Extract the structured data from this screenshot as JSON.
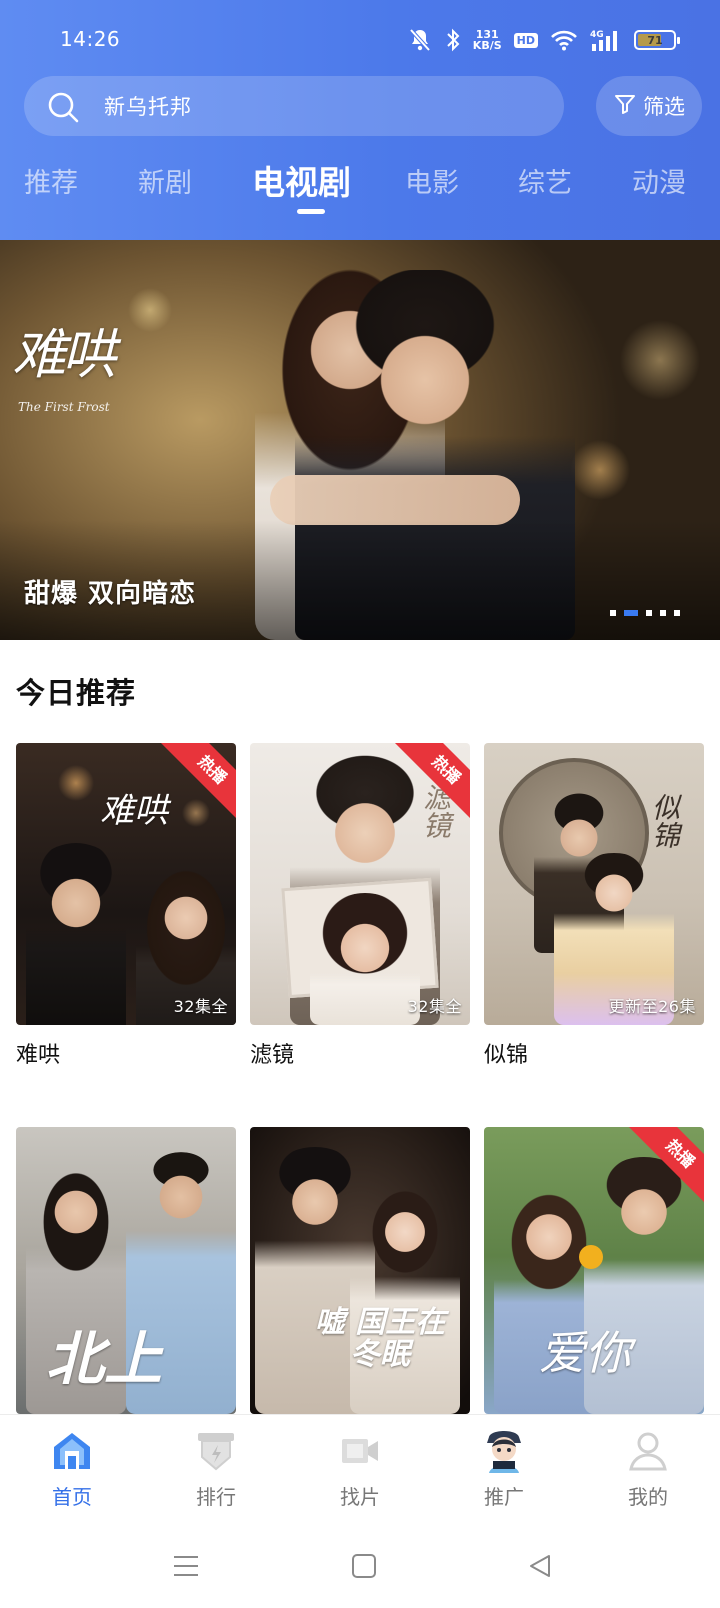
{
  "status_bar": {
    "time": "14:26",
    "net_speed_value": "131",
    "net_speed_unit": "KB/S",
    "hd": "HD",
    "signal": "4G",
    "battery": "71",
    "battery_level": 0.71,
    "icons": [
      "mute-icon",
      "bluetooth-icon",
      "wifi-icon",
      "cell-signal-icon",
      "battery-icon"
    ]
  },
  "search": {
    "value": "新乌托邦",
    "icon": "search-icon"
  },
  "filter": {
    "label": "筛选",
    "icon": "filter-icon"
  },
  "tabs": [
    {
      "label": "推荐",
      "active": false
    },
    {
      "label": "新剧",
      "active": false
    },
    {
      "label": "电视剧",
      "active": true
    },
    {
      "label": "电影",
      "active": false
    },
    {
      "label": "综艺",
      "active": false
    },
    {
      "label": "动漫",
      "active": false
    }
  ],
  "banner": {
    "logo_text": "难哄",
    "logo_sub": "The First Frost",
    "caption": "甜爆 双向暗恋",
    "dot_count": 5,
    "active_dot": 1
  },
  "section": {
    "title": "今日推荐",
    "hot_label": "热播",
    "items": [
      {
        "title": "难哄",
        "episodes": "32集全",
        "hot": true,
        "logo": "难哄"
      },
      {
        "title": "滤镜",
        "episodes": "32集全",
        "hot": true,
        "logo": "滤镜"
      },
      {
        "title": "似锦",
        "episodes": "更新至26集",
        "hot": false,
        "logo": "似锦"
      },
      {
        "title": "",
        "episodes": "",
        "hot": false,
        "logo": "北上"
      },
      {
        "title": "",
        "episodes": "",
        "hot": false,
        "logo": "嘘 国王在冬眠"
      },
      {
        "title": "",
        "episodes": "",
        "hot": true,
        "logo": "爱你"
      }
    ]
  },
  "bottom_nav": [
    {
      "label": "首页",
      "icon": "home-icon",
      "active": true
    },
    {
      "label": "排行",
      "icon": "ranking-icon",
      "active": false
    },
    {
      "label": "找片",
      "icon": "video-camera-icon",
      "active": false
    },
    {
      "label": "推广",
      "icon": "promo-avatar-icon",
      "active": false
    },
    {
      "label": "我的",
      "icon": "user-icon",
      "active": false
    }
  ],
  "system_nav": [
    "menu-icon",
    "home-square-icon",
    "back-triangle-icon"
  ],
  "colors": {
    "header_start": "#5f8cf2",
    "header_end": "#4a72e4",
    "accent": "#3470e8",
    "hot": "#e8343b"
  }
}
